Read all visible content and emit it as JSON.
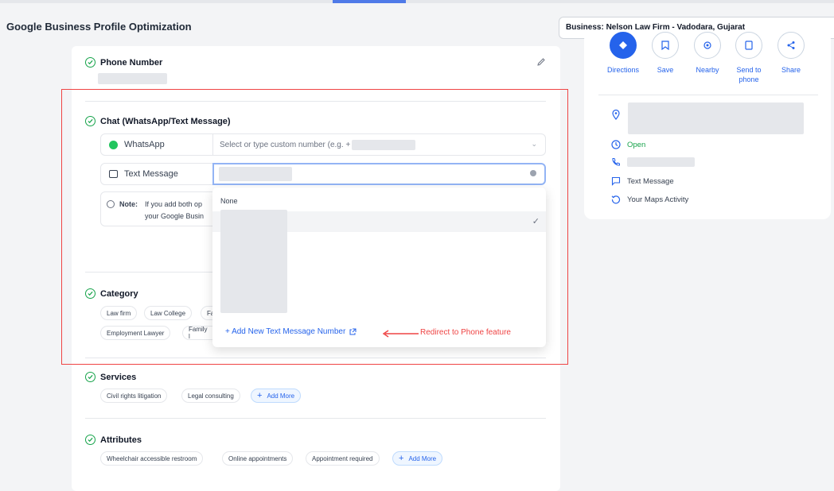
{
  "page": {
    "title": "Google Business Profile Optimization"
  },
  "business_selector": {
    "value": "Business: Nelson Law Firm - Vadodara, Gujarat"
  },
  "sections": {
    "phone": {
      "title": "Phone Number"
    },
    "chat": {
      "title": "Chat (WhatsApp/Text Message)",
      "whatsapp": {
        "label": "WhatsApp",
        "placeholder": "Select or type custom number (e.g. +"
      },
      "text_message": {
        "label": "Text Message"
      },
      "note": {
        "prefix": "Note:",
        "line1": "If you add both op",
        "line2": "your Google Busin"
      }
    },
    "category": {
      "title": "Category",
      "chips": [
        "Law firm",
        "Law College",
        "Fa",
        "Employment Lawyer",
        "Family l"
      ]
    },
    "services": {
      "title": "Services",
      "chips": [
        "Civil rights litigation",
        "Legal consulting"
      ],
      "add": "Add More"
    },
    "attributes": {
      "title": "Attributes",
      "chips": [
        "Wheelchair accessible restroom",
        "Online appointments",
        "Appointment required"
      ],
      "add": "Add More"
    }
  },
  "dropdown": {
    "none_label": "None",
    "add_link": "+ Add New Text Message Number",
    "selected_check": "✓"
  },
  "annotation": {
    "text": "Redirect to Phone feature",
    "color": "#ef4444"
  },
  "side_panel": {
    "actions": [
      {
        "label": "Directions",
        "icon": "directions-icon"
      },
      {
        "label": "Save",
        "icon": "bookmark-icon"
      },
      {
        "label": "Nearby",
        "icon": "nearby-icon"
      },
      {
        "label": "Send to phone",
        "icon": "send-to-phone-icon"
      },
      {
        "label": "Share",
        "icon": "share-icon"
      }
    ],
    "status": "Open",
    "text_message": "Text Message",
    "maps_activity": "Your Maps Activity"
  },
  "colors": {
    "accent": "#2563eb",
    "success": "#16a34a",
    "annotation": "#ef4444"
  }
}
